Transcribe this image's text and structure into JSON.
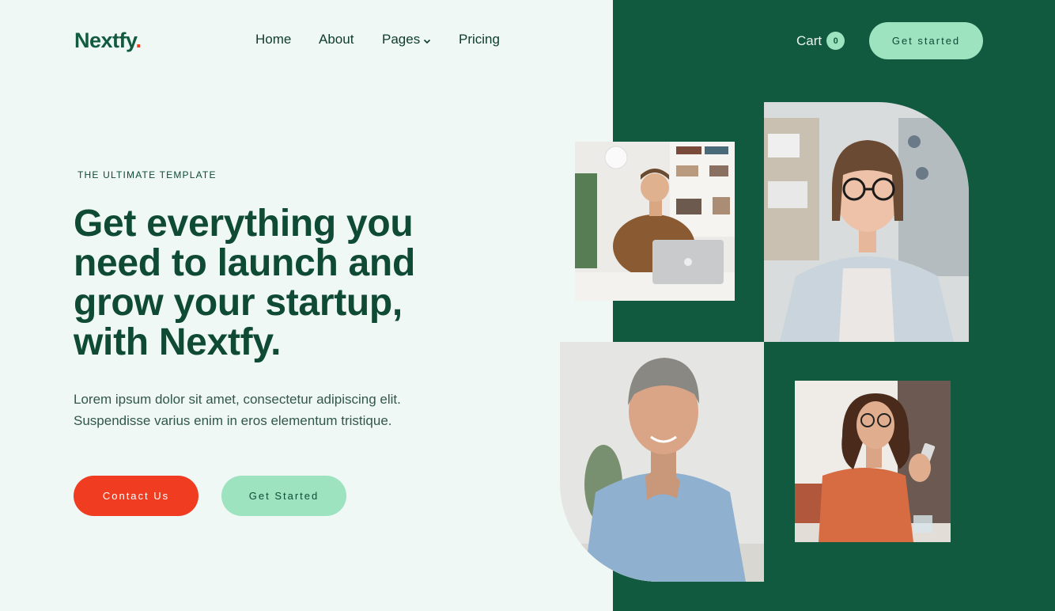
{
  "brand": {
    "name": "Nextfy",
    "dot": "."
  },
  "nav": {
    "items": [
      {
        "label": "Home"
      },
      {
        "label": "About"
      },
      {
        "label": "Pages"
      },
      {
        "label": "Pricing"
      }
    ],
    "cart_label": "Cart",
    "cart_count": "0",
    "cta_label": "Get started"
  },
  "hero": {
    "eyebrow": "THE ULTIMATE TEMPLATE",
    "headline": "Get everything you need to launch and grow your startup, with Nextfy.",
    "subtext": "Lorem ipsum dolor sit amet, consectetur adipiscing elit. Suspendisse varius enim in eros elementum tristique.",
    "primary_button": "Contact Us",
    "secondary_button": "Get Started"
  },
  "colors": {
    "brand_green": "#115a40",
    "mint": "#9de3c0",
    "accent_red": "#f03d22",
    "background": "#eff8f5"
  },
  "icons": {
    "pages_dropdown": "chevron-down-icon"
  }
}
